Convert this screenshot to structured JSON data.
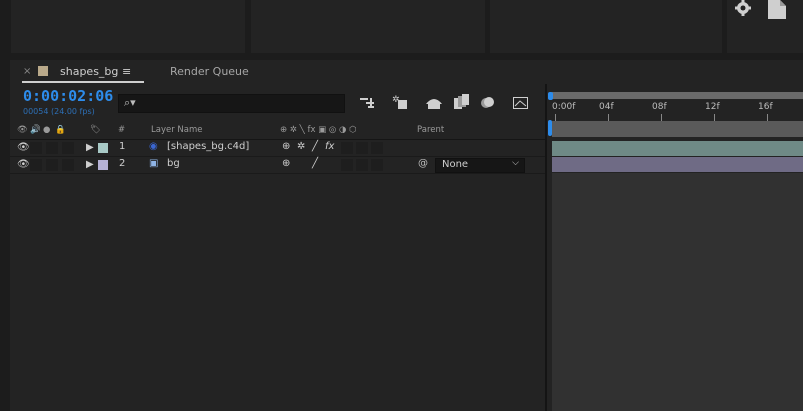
{
  "tab": {
    "close": "×",
    "label": "shapes_bg",
    "menu": "≡",
    "render_queue": "Render Queue"
  },
  "comp": {
    "timecode": "0:00:02:06",
    "frames": "00054 (24.00 fps)",
    "search_placeholder": ""
  },
  "columns": {
    "num": "#",
    "layer_name": "Layer Name",
    "parent": "Parent"
  },
  "layers": [
    {
      "index": "1",
      "name": "[shapes_bg.c4d]",
      "color": "#a8c9c6",
      "fx": "fx"
    },
    {
      "index": "2",
      "name": "bg",
      "color": "#b6b2d6",
      "parent": "None"
    }
  ],
  "ruler": [
    "0:00f",
    "04f",
    "08f",
    "12f",
    "16f"
  ],
  "colors": {
    "accent": "#2d8ceb",
    "track1": "#6f8a86",
    "track2": "#6f6b85"
  }
}
